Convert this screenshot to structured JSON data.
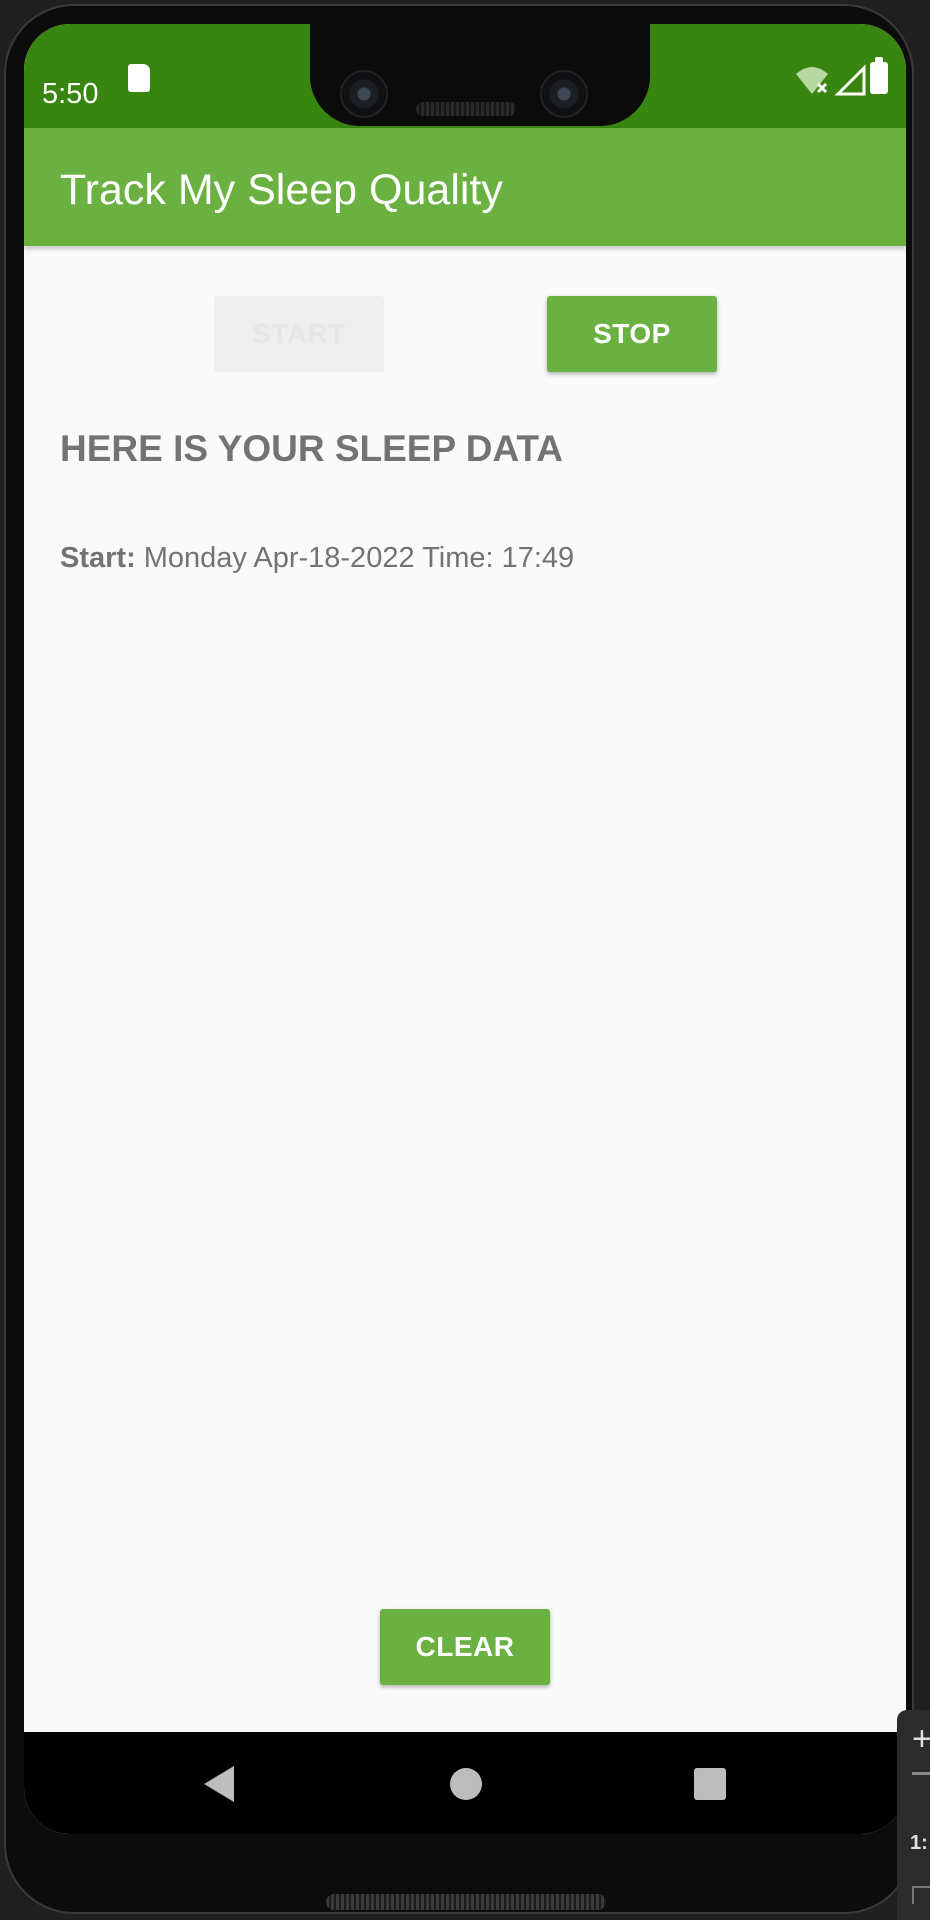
{
  "status_bar": {
    "time": "5:50",
    "icons": [
      "sd-card-icon",
      "wifi-icon",
      "cell-signal-icon",
      "battery-icon"
    ],
    "color": "#38850f"
  },
  "app_bar": {
    "title": "Track My Sleep Quality",
    "color": "#6bb142"
  },
  "controls": {
    "start_label": "START",
    "stop_label": "STOP",
    "clear_label": "CLEAR"
  },
  "sleep_data": {
    "heading": "HERE IS YOUR SLEEP DATA",
    "start_label": "Start:",
    "start_value": "Monday Apr-18-2022 Time: 17:49"
  },
  "nav_bar": {
    "icons": [
      "back-icon",
      "home-icon",
      "recents-icon"
    ]
  },
  "emulator_panel": {
    "plus": "+",
    "zoom": "1:"
  }
}
